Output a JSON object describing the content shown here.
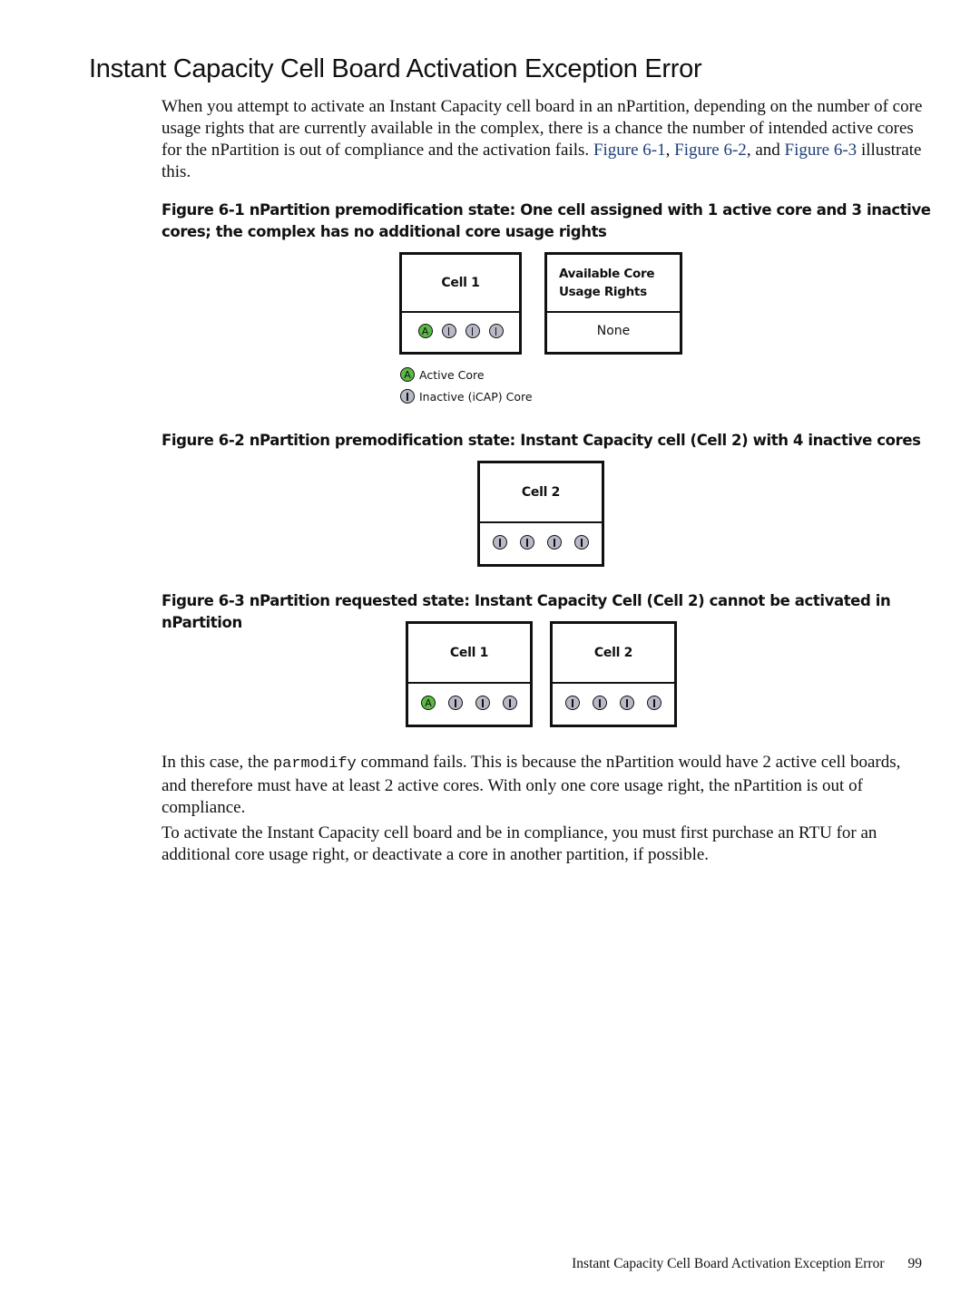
{
  "section": {
    "title": "Instant Capacity Cell Board Activation Exception Error"
  },
  "intro": {
    "text": "When you attempt to activate an Instant Capacity cell board in an nPartition, depending on the number of core usage rights that are currently available in the complex, there is a chance the number of intended active cores for the nPartition is out of compliance and the activation fails.",
    "link1": "Figure 6-1",
    "sep1": ", ",
    "link2": "Figure 6-2",
    "sep2": ", and ",
    "link3": "Figure 6-3",
    "tail": " illustrate this."
  },
  "figure1": {
    "caption": "Figure 6-1 nPartition premodification state: One cell assigned with 1 active core and 3 inactive cores; the complex has no additional core usage rights",
    "cell": {
      "label": "Cell 1",
      "cores": [
        "A",
        "I",
        "I",
        "I"
      ]
    },
    "rights": {
      "label": "Available Core Usage Rights",
      "label_line1": "Available Core",
      "label_line2": "Usage Rights",
      "value": "None"
    },
    "legend": [
      {
        "symbol": "A",
        "label": "Active Core"
      },
      {
        "symbol": "I",
        "label": "Inactive (iCAP) Core"
      }
    ]
  },
  "figure2": {
    "caption": "Figure 6-2 nPartition premodification state: Instant Capacity cell (Cell 2) with 4 inactive cores",
    "cell": {
      "label": "Cell 2",
      "cores": [
        "I",
        "I",
        "I",
        "I"
      ]
    }
  },
  "figure3": {
    "caption": "Figure 6-3 nPartition requested state: Instant Capacity Cell (Cell 2) cannot be activated in nPartition",
    "cells": [
      {
        "label": "Cell 1",
        "cores": [
          "A",
          "I",
          "I",
          "I"
        ]
      },
      {
        "label": "Cell 2",
        "cores": [
          "I",
          "I",
          "I",
          "I"
        ]
      }
    ]
  },
  "body": {
    "p1_before": "In this case, the ",
    "p1_code": "parmodify",
    "p1_after": " command fails. This is because the nPartition would have 2 active cell boards, and therefore must have at least 2 active cores. With only one core usage right, the nPartition is out of compliance.",
    "p2": "To activate the Instant Capacity cell board and be in compliance, you must first purchase an RTU for an additional core usage right, or deactivate a core in another partition, if possible."
  },
  "colors": {
    "active_core": "#5cb946",
    "inactive_core": "#b7b9c6",
    "link": "#1f3f7a"
  },
  "footer": {
    "running_title": "Instant Capacity Cell Board Activation Exception Error",
    "page_number": "99"
  }
}
